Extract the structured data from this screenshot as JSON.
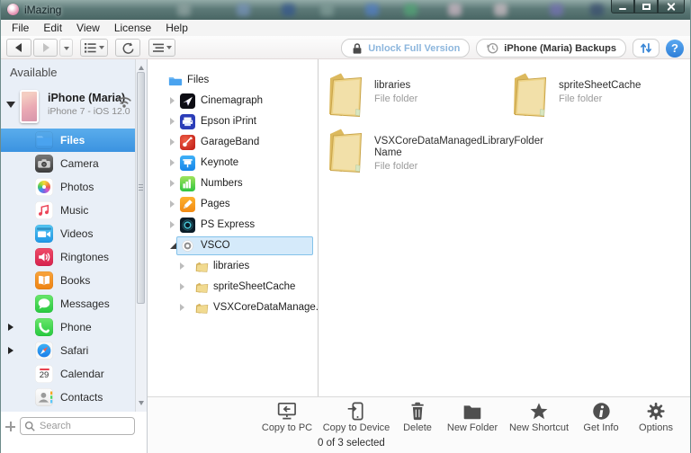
{
  "titlebar": {
    "title": "iMazing",
    "controls": [
      "minimize",
      "maximize",
      "close"
    ]
  },
  "menu": {
    "items": [
      "File",
      "Edit",
      "View",
      "License",
      "Help"
    ]
  },
  "toolbar": {
    "unlock_label": "Unlock Full Version",
    "backups_label": "iPhone (Maria) Backups",
    "help_label": "?",
    "icons": [
      "back-icon",
      "forward-icon",
      "dropdown-caret-icon",
      "view-list-icon",
      "refresh-icon",
      "actions-menu-icon",
      "lock-icon",
      "history-icon",
      "transfer-arrows-icon",
      "help-icon"
    ]
  },
  "sidebar": {
    "header": "Available",
    "device": {
      "name": "iPhone (Maria)",
      "details": "iPhone 7 - iOS 12.0",
      "icons": [
        "disclosure-down-icon",
        "iphone-thumbnail",
        "wifi-icon"
      ]
    },
    "items": [
      {
        "label": "Files",
        "icon": "files-icon",
        "selected": true
      },
      {
        "label": "Camera",
        "icon": "camera-icon"
      },
      {
        "label": "Photos",
        "icon": "photos-icon"
      },
      {
        "label": "Music",
        "icon": "music-icon"
      },
      {
        "label": "Videos",
        "icon": "videos-icon"
      },
      {
        "label": "Ringtones",
        "icon": "ringtones-icon"
      },
      {
        "label": "Books",
        "icon": "books-icon"
      },
      {
        "label": "Messages",
        "icon": "messages-icon"
      },
      {
        "label": "Phone",
        "icon": "phone-icon",
        "expandable": true
      },
      {
        "label": "Safari",
        "icon": "safari-icon",
        "expandable": true
      },
      {
        "label": "Calendar",
        "icon": "calendar-icon",
        "day": "29"
      },
      {
        "label": "Contacts",
        "icon": "contacts-icon"
      }
    ],
    "search_placeholder": "Search"
  },
  "tree": {
    "items": [
      {
        "label": "Files",
        "icon": "folder-blue-icon",
        "level": 0
      },
      {
        "label": "Cinemagraph",
        "icon": "cinemagraph-icon",
        "level": 1,
        "disclosure": "collapsed"
      },
      {
        "label": "Epson iPrint",
        "icon": "epson-iprint-icon",
        "level": 1,
        "disclosure": "collapsed"
      },
      {
        "label": "GarageBand",
        "icon": "garageband-icon",
        "level": 1,
        "disclosure": "collapsed"
      },
      {
        "label": "Keynote",
        "icon": "keynote-icon",
        "level": 1,
        "disclosure": "collapsed"
      },
      {
        "label": "Numbers",
        "icon": "numbers-icon",
        "level": 1,
        "disclosure": "collapsed"
      },
      {
        "label": "Pages",
        "icon": "pages-icon",
        "level": 1,
        "disclosure": "collapsed"
      },
      {
        "label": "PS Express",
        "icon": "ps-express-icon",
        "level": 1,
        "disclosure": "collapsed"
      },
      {
        "label": "VSCO",
        "icon": "vsco-icon",
        "level": 1,
        "disclosure": "expanded",
        "selected": true
      },
      {
        "label": "libraries",
        "icon": "folder-manila-icon",
        "level": 2,
        "disclosure": "collapsed"
      },
      {
        "label": "spriteSheetCache",
        "icon": "folder-manila-icon",
        "level": 2,
        "disclosure": "collapsed"
      },
      {
        "label": "VSXCoreDataManage...",
        "icon": "folder-manila-icon",
        "level": 2,
        "disclosure": "collapsed"
      }
    ]
  },
  "content": {
    "folders": [
      {
        "name": "libraries",
        "type": "File folder"
      },
      {
        "name": "spriteSheetCache",
        "type": "File folder"
      },
      {
        "name": "VSXCoreDataManagedLibraryFolderName",
        "type": "File folder"
      }
    ]
  },
  "actionbar": {
    "buttons": [
      {
        "label": "Copy to PC",
        "icon": "copy-to-pc-icon"
      },
      {
        "label": "Copy to Device",
        "icon": "copy-to-device-icon"
      },
      {
        "label": "Delete",
        "icon": "trash-icon"
      },
      {
        "label": "New Folder",
        "icon": "new-folder-icon"
      },
      {
        "label": "New Shortcut",
        "icon": "star-icon"
      },
      {
        "label": "Get Info",
        "icon": "info-icon"
      },
      {
        "label": "Options",
        "icon": "gear-icon"
      }
    ],
    "status": "0 of 3 selected"
  },
  "colors": {
    "selection_blue": "#459fe6",
    "tree_selection": "#d5eafa",
    "accent_blue": "#3f8ee8",
    "unlock_text": "#8cb6dd",
    "titlebar_teal": "#5d7a78",
    "folder_yellow": "#eed488",
    "sidebar_bg": "#e9eff7"
  }
}
